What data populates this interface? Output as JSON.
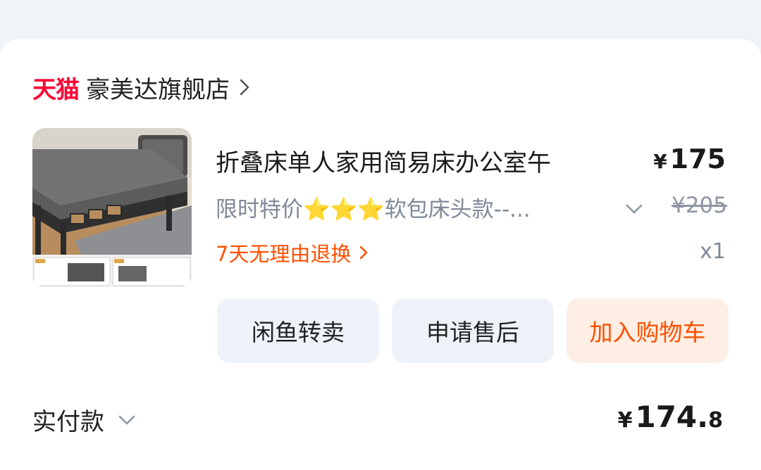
{
  "shop": {
    "platform_logo": "天猫",
    "name": "豪美达旗舰店",
    "chevron_icon": "chevron-right-icon"
  },
  "product": {
    "image_icon": "folding-bed-image",
    "title": "折叠床单人家用简易床办公室午",
    "price_symbol": "¥",
    "price": "175",
    "sku_text": "限时特价⭐⭐⭐软包床头款--...",
    "original_price": "¥205",
    "return_policy": "7天无理由退换",
    "quantity": "x1"
  },
  "actions": {
    "xianyu_label": "闲鱼转卖",
    "aftersale_label": "申请售后",
    "cart_label": "加入购物车"
  },
  "payment": {
    "label": "实付款",
    "symbol": "¥",
    "amount_int": "174.",
    "amount_dec": "8"
  },
  "colors": {
    "tmall_red": "#ff0036",
    "accent_orange": "#ff5000",
    "muted_text": "#7f8a99",
    "button_bg": "#edf3f9",
    "cart_button_bg": "#ffeee4"
  }
}
